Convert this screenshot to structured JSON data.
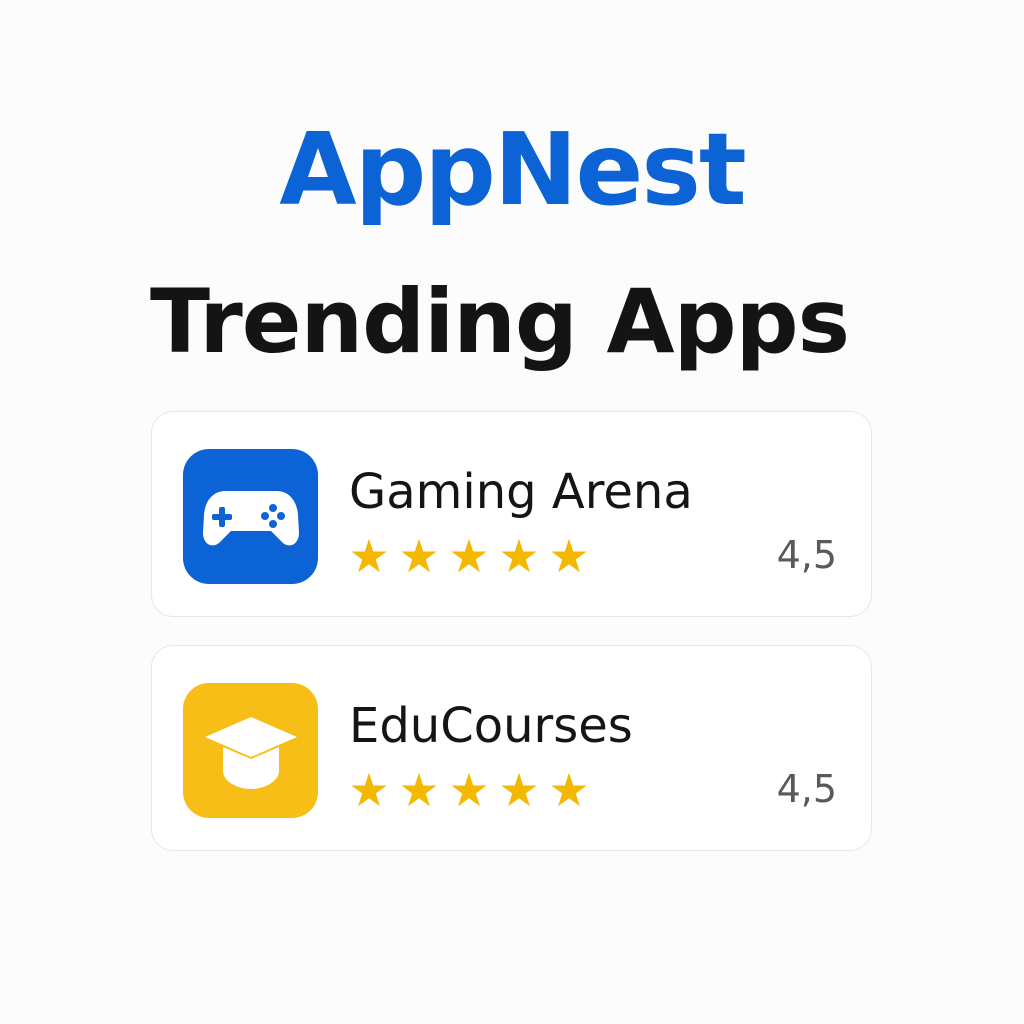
{
  "brand": {
    "name": "AppNest",
    "color": "#0b63d6"
  },
  "section": {
    "title": "Trending Apps"
  },
  "apps": [
    {
      "name": "Gaming Arena",
      "icon": "gamepad-icon",
      "icon_color": "#0b63d6",
      "stars": [
        "★",
        "★",
        "★",
        "★",
        "★"
      ],
      "star_color": "#f5b800",
      "rating": "4,5"
    },
    {
      "name": "EduCourses",
      "icon": "graduation-cap-icon",
      "icon_color": "#f7be17",
      "stars": [
        "★",
        "★",
        "★",
        "★",
        "★"
      ],
      "star_color": "#f5b800",
      "rating": "4,5"
    }
  ]
}
